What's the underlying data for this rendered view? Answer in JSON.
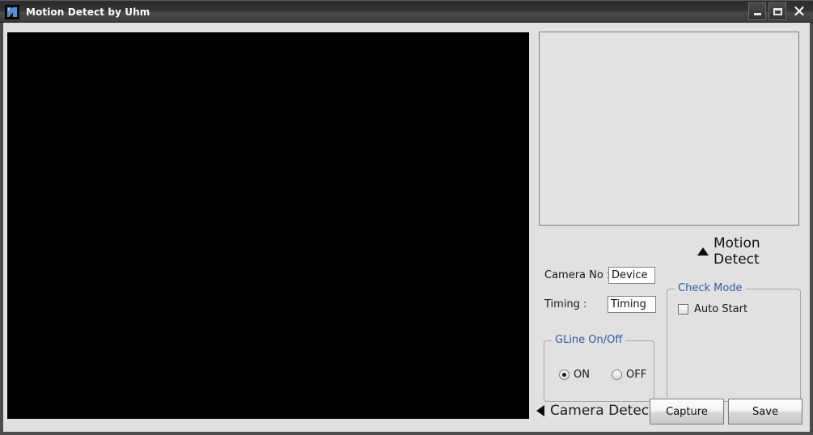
{
  "window": {
    "title": "Motion Detect by Uhm",
    "icon": "app-logo-icon",
    "controls": {
      "minimize_label": "",
      "maximize_label": "",
      "close_label": "✕"
    }
  },
  "panels": {
    "video_preview_label": "",
    "capture_preview_label": ""
  },
  "motion_detect": {
    "header_label": "Motion Detect",
    "arrow": "triangle-up"
  },
  "camera_detect": {
    "footer_label": "Camera Detect",
    "arrow": "triangle-left"
  },
  "fields": {
    "camera_no": {
      "label": "Camera No :",
      "value": "Device",
      "placeholder": "Device"
    },
    "timing": {
      "label": "Timing :",
      "value": "Timing",
      "placeholder": "Timing"
    }
  },
  "gline_group": {
    "title": "GLine On/Off",
    "options": [
      {
        "label": "ON",
        "selected": true
      },
      {
        "label": "OFF",
        "selected": false
      }
    ]
  },
  "check_mode_group": {
    "title": "Check Mode",
    "checkbox": {
      "label": "Auto Start",
      "checked": false
    }
  },
  "buttons": {
    "capture_label": "Capture",
    "save_label": "Save"
  },
  "colors": {
    "titlebar_dark": "#343434",
    "frame_gray": "#4c4c4c",
    "surface": "#e1e1e1",
    "group_title_blue": "#2c5aa8",
    "video_black": "#000000",
    "preview_gray": "#e3e3e3"
  }
}
